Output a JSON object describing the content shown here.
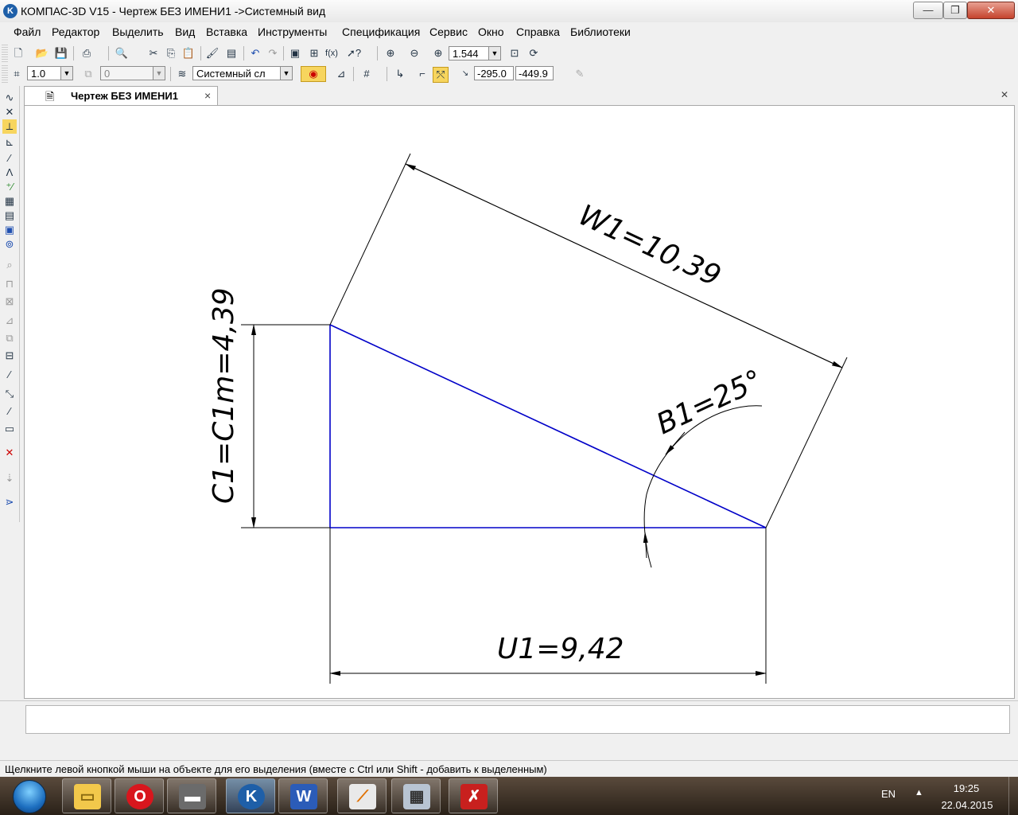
{
  "window": {
    "title": "КОМПАС-3D V15 - Чертеж БЕЗ ИМЕНИ1 ->Системный вид",
    "app_icon": "K"
  },
  "menu": [
    "Файл",
    "Редактор",
    "Выделить",
    "Вид",
    "Вставка",
    "Инструменты",
    "Спецификация",
    "Сервис",
    "Окно",
    "Справка",
    "Библиотеки"
  ],
  "toolbar1": {
    "zoom_value": "1.544"
  },
  "toolbar2": {
    "line_scale": "1.0",
    "layer_value": "0",
    "style_value": "Системный сл",
    "coord_x": "-295.0",
    "coord_y": "-449.9"
  },
  "tab": {
    "title": "Чертеж БЕЗ ИМЕНИ1",
    "close": "×"
  },
  "drawing": {
    "dim_w": "W1=10,39",
    "dim_b": "B1=25°",
    "dim_c": "C1=C1m=4,39",
    "dim_u": "U1=9,42",
    "line_color": "#0000c8"
  },
  "status_text": "Щелкните левой кнопкой мыши на объекте для его выделения (вместе с Ctrl или Shift - добавить к выделенным)",
  "taskbar": {
    "lang": "EN",
    "time": "19:25",
    "date": "22.04.2015",
    "apps": [
      "folder-icon",
      "opera-icon",
      "terminal-icon",
      "kompas-icon",
      "word-icon",
      "cad-icon",
      "calculator-icon",
      "pdf-icon"
    ]
  },
  "colors": {
    "accent": "#1e5fa8",
    "close_red": "#c5432c"
  }
}
